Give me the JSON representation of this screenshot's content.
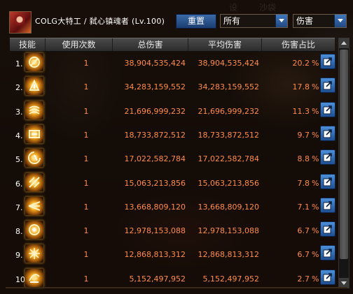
{
  "header": {
    "title": "COLG大特工 / 弑心镇魂者 (Lv.100)",
    "reset_label": "重置",
    "filter_left": "所有",
    "filter_right": "伤害"
  },
  "background_tabs": [
    "设",
    "沙袋"
  ],
  "columns": [
    "技能",
    "使用次数",
    "总伤害",
    "平均伤害",
    "伤害占比"
  ],
  "rows": [
    {
      "index": "1.",
      "skill_icon": "skill-icon-1",
      "uses": "1",
      "total": "38,904,535,424",
      "average": "38,904,535,424",
      "percent": "20.2",
      "unit": "%"
    },
    {
      "index": "2.",
      "skill_icon": "skill-icon-2",
      "uses": "1",
      "total": "34,283,159,552",
      "average": "34,283,159,552",
      "percent": "17.8",
      "unit": "%"
    },
    {
      "index": "3.",
      "skill_icon": "skill-icon-3",
      "uses": "1",
      "total": "21,696,999,232",
      "average": "21,696,999,232",
      "percent": "11.3",
      "unit": "%"
    },
    {
      "index": "4.",
      "skill_icon": "skill-icon-4",
      "uses": "1",
      "total": "18,733,872,512",
      "average": "18,733,872,512",
      "percent": "9.7",
      "unit": "%"
    },
    {
      "index": "5.",
      "skill_icon": "skill-icon-5",
      "uses": "1",
      "total": "17,022,582,784",
      "average": "17,022,582,784",
      "percent": "8.8",
      "unit": "%"
    },
    {
      "index": "6.",
      "skill_icon": "skill-icon-6",
      "uses": "1",
      "total": "15,063,213,856",
      "average": "15,063,213,856",
      "percent": "7.8",
      "unit": "%"
    },
    {
      "index": "7.",
      "skill_icon": "skill-icon-7",
      "uses": "1",
      "total": "13,668,809,120",
      "average": "13,668,809,120",
      "percent": "7.1",
      "unit": "%"
    },
    {
      "index": "8.",
      "skill_icon": "skill-icon-8",
      "uses": "1",
      "total": "12,978,153,088",
      "average": "12,978,153,088",
      "percent": "6.7",
      "unit": "%"
    },
    {
      "index": "9.",
      "skill_icon": "skill-icon-9",
      "uses": "1",
      "total": "12,868,813,312",
      "average": "12,868,813,312",
      "percent": "6.7",
      "unit": "%"
    },
    {
      "index": "10.",
      "skill_icon": "skill-icon-10",
      "uses": "1",
      "total": "5,152,497,952",
      "average": "5,152,497,952",
      "percent": "2.7",
      "unit": "%"
    }
  ],
  "colors": {
    "value_text": "#ff8c4a",
    "header_bg": "#3a3a3a",
    "button_blue": "#2d5c9e"
  }
}
